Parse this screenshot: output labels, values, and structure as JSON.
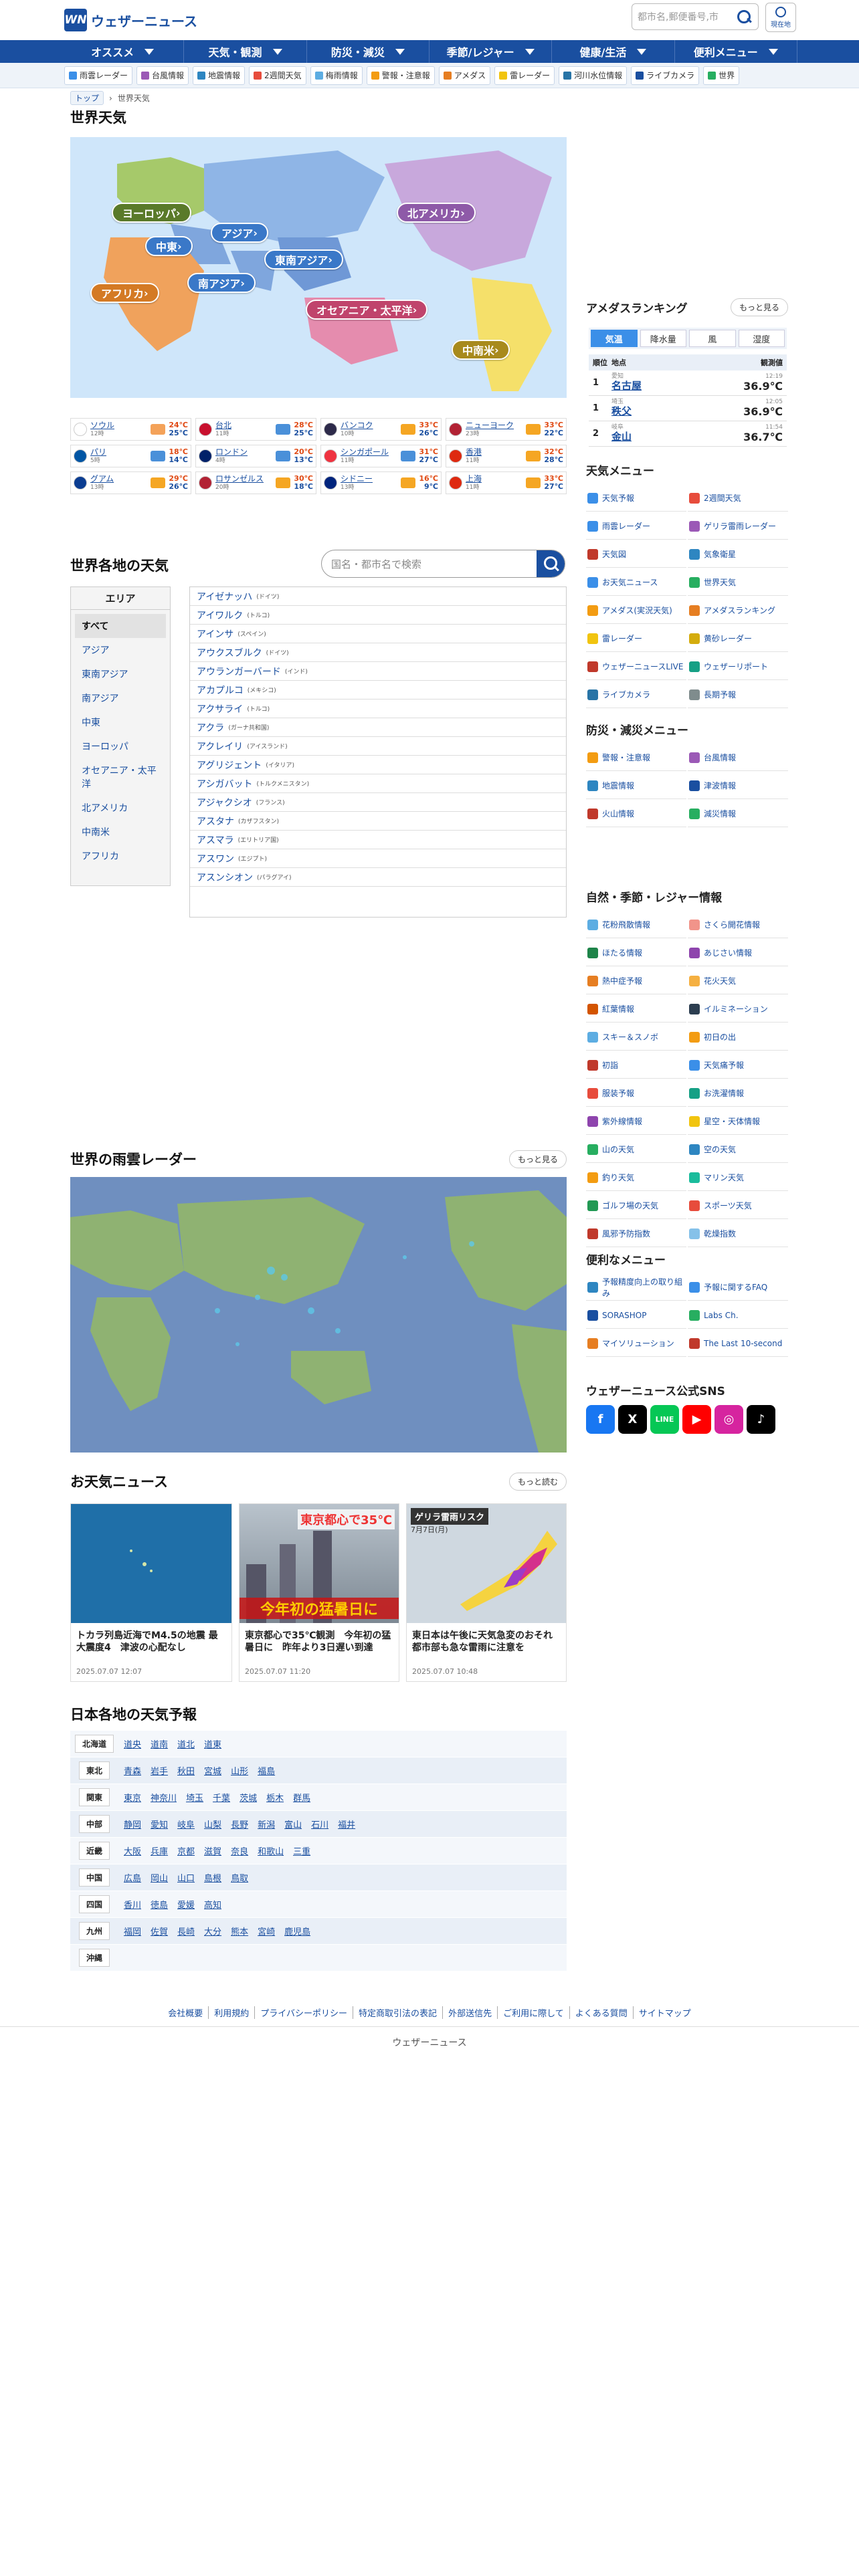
{
  "header": {
    "logo_mark": "WN",
    "logo_text": "ウェザーニュース",
    "search_placeholder": "都市名,郵便番号,市",
    "location_label": "現在地"
  },
  "gnav": [
    "オススメ",
    "天気・観測",
    "防災・減災",
    "季節/レジャー",
    "健康/生活",
    "便利メニュー"
  ],
  "subnav": [
    {
      "label": "雨雲レーダー",
      "color": "#3b8fe8"
    },
    {
      "label": "台風情報",
      "color": "#9b59b6"
    },
    {
      "label": "地震情報",
      "color": "#2e86c1"
    },
    {
      "label": "2週間天気",
      "color": "#e74c3c"
    },
    {
      "label": "梅雨情報",
      "color": "#5dade2"
    },
    {
      "label": "警報・注意報",
      "color": "#f39c12"
    },
    {
      "label": "アメダス",
      "color": "#e67e22"
    },
    {
      "label": "雷レーダー",
      "color": "#f1c40f"
    },
    {
      "label": "河川水位情報",
      "color": "#2874a6"
    },
    {
      "label": "ライブカメラ",
      "color": "#1a4fa0"
    },
    {
      "label": "世界",
      "color": "#27ae60"
    }
  ],
  "breadcrumb": {
    "home": "トップ",
    "current": "世界天気"
  },
  "page_title": "世界天気",
  "regions": [
    {
      "label": "ヨーロッパ",
      "color": "#5a7a2a"
    },
    {
      "label": "アジア",
      "color": "#3a78c8"
    },
    {
      "label": "中東",
      "color": "#3a78c8"
    },
    {
      "label": "北アメリカ",
      "color": "#8e5aa8"
    },
    {
      "label": "東南アジア",
      "color": "#3a78c8"
    },
    {
      "label": "アフリカ",
      "color": "#d47a24"
    },
    {
      "label": "南アジア",
      "color": "#3a78c8"
    },
    {
      "label": "オセアニア・太平洋",
      "color": "#c0446c"
    },
    {
      "label": "中南米",
      "color": "#a88a1c"
    }
  ],
  "cities": [
    {
      "name": "ソウル",
      "time": "12時",
      "hi": "24℃",
      "lo": "25℃",
      "flag": "#ffffff",
      "icon": "#f4a259"
    },
    {
      "name": "台北",
      "time": "11時",
      "hi": "28℃",
      "lo": "25℃",
      "flag": "#c8102e",
      "icon": "#4a90d9"
    },
    {
      "name": "バンコク",
      "time": "10時",
      "hi": "33℃",
      "lo": "26℃",
      "flag": "#2d2a4a",
      "icon": "#f5a623"
    },
    {
      "name": "ニューヨーク",
      "time": "23時",
      "hi": "33℃",
      "lo": "22℃",
      "flag": "#b22234",
      "icon": "#f5a623"
    },
    {
      "name": "パリ",
      "time": "5時",
      "hi": "18℃",
      "lo": "14℃",
      "flag": "#0055a4",
      "icon": "#4a90d9"
    },
    {
      "name": "ロンドン",
      "time": "4時",
      "hi": "20℃",
      "lo": "13℃",
      "flag": "#012169",
      "icon": "#4a90d9"
    },
    {
      "name": "シンガポール",
      "time": "11時",
      "hi": "31℃",
      "lo": "27℃",
      "flag": "#ef3340",
      "icon": "#4a90d9"
    },
    {
      "name": "香港",
      "time": "11時",
      "hi": "32℃",
      "lo": "28℃",
      "flag": "#de2910",
      "icon": "#f5a623"
    },
    {
      "name": "グアム",
      "time": "13時",
      "hi": "29℃",
      "lo": "26℃",
      "flag": "#0b3d91",
      "icon": "#f5a623"
    },
    {
      "name": "ロサンゼルス",
      "time": "20時",
      "hi": "30℃",
      "lo": "18℃",
      "flag": "#b22234",
      "icon": "#f5a623"
    },
    {
      "name": "シドニー",
      "time": "13時",
      "hi": "16℃",
      "lo": "9℃",
      "flag": "#00247d",
      "icon": "#f5a623"
    },
    {
      "name": "上海",
      "time": "11時",
      "hi": "33℃",
      "lo": "27℃",
      "flag": "#de2910",
      "icon": "#f5a623"
    }
  ],
  "area_section": {
    "title": "世界各地の天気",
    "search_placeholder": "国名・都市名で検索",
    "area_header": "エリア",
    "areas": [
      "すべて",
      "アジア",
      "東南アジア",
      "南アジア",
      "中東",
      "ヨーロッパ",
      "オセアニア・太平洋",
      "北アメリカ",
      "中南米",
      "アフリカ"
    ],
    "city_list": [
      {
        "name": "アイゼナッハ",
        "country": "(ドイツ)"
      },
      {
        "name": "アイワルク",
        "country": "(トルコ)"
      },
      {
        "name": "アインサ",
        "country": "(スペイン)"
      },
      {
        "name": "アウクスブルク",
        "country": "(ドイツ)"
      },
      {
        "name": "アウランガーバード",
        "country": "(インド)"
      },
      {
        "name": "アカプルコ",
        "country": "(メキシコ)"
      },
      {
        "name": "アクサライ",
        "country": "(トルコ)"
      },
      {
        "name": "アクラ",
        "country": "(ガーナ共和国)"
      },
      {
        "name": "アクレイリ",
        "country": "(アイスランド)"
      },
      {
        "name": "アグリジェント",
        "country": "(イタリア)"
      },
      {
        "name": "アシガバット",
        "country": "(トルクメニスタン)"
      },
      {
        "name": "アジャクシオ",
        "country": "(フランス)"
      },
      {
        "name": "アスタナ",
        "country": "(カザフスタン)"
      },
      {
        "name": "アスマラ",
        "country": "(エリトリア国)"
      },
      {
        "name": "アスワン",
        "country": "(エジプト)"
      },
      {
        "name": "アスンシオン",
        "country": "(パラグアイ)"
      }
    ]
  },
  "radar_section": {
    "title": "世界の雨雲レーダー",
    "more": "もっと見る"
  },
  "news_section": {
    "title": "お天気ニュース",
    "more": "もっと読む",
    "items": [
      {
        "title": "トカラ列島近海でM4.5の地震 最大震度4　津波の心配なし",
        "date": "2025.07.07 12:07",
        "img_caption": ""
      },
      {
        "title": "東京都心で35℃観測　今年初の猛暑日に　昨年より3日遅い到達",
        "date": "2025.07.07 11:20",
        "img_caption": "東京都心で35℃",
        "img_caption2": "今年初の猛暑日に"
      },
      {
        "title": "東日本は午後に天気急変のおそれ　都市部も急な雷雨に注意を",
        "date": "2025.07.07 10:48",
        "img_caption": "ゲリラ雷雨リスク",
        "img_caption2": "7月7日(月)"
      }
    ]
  },
  "forecast_section": {
    "title": "日本各地の天気予報",
    "rows": [
      {
        "region": "北海道",
        "prefs": [
          "道央",
          "道南",
          "道北",
          "道東"
        ]
      },
      {
        "region": "東北",
        "prefs": [
          "青森",
          "岩手",
          "秋田",
          "宮城",
          "山形",
          "福島"
        ]
      },
      {
        "region": "関東",
        "prefs": [
          "東京",
          "神奈川",
          "埼玉",
          "千葉",
          "茨城",
          "栃木",
          "群馬"
        ]
      },
      {
        "region": "中部",
        "prefs": [
          "静岡",
          "愛知",
          "岐阜",
          "山梨",
          "長野",
          "新潟",
          "富山",
          "石川",
          "福井"
        ]
      },
      {
        "region": "近畿",
        "prefs": [
          "大阪",
          "兵庫",
          "京都",
          "滋賀",
          "奈良",
          "和歌山",
          "三重"
        ]
      },
      {
        "region": "中国",
        "prefs": [
          "広島",
          "岡山",
          "山口",
          "島根",
          "鳥取"
        ]
      },
      {
        "region": "四国",
        "prefs": [
          "香川",
          "徳島",
          "愛媛",
          "高知"
        ]
      },
      {
        "region": "九州",
        "prefs": [
          "福岡",
          "佐賀",
          "長崎",
          "大分",
          "熊本",
          "宮崎",
          "鹿児島"
        ]
      },
      {
        "region": "沖縄",
        "prefs": []
      }
    ]
  },
  "footer": {
    "links": [
      "会社概要",
      "利用規約",
      "プライバシーポリシー",
      "特定商取引法の表記",
      "外部送信先",
      "ご利用に際して",
      "よくある質問",
      "サイトマップ"
    ],
    "copyright": "ウェザーニュース"
  },
  "sidebar": {
    "amedas": {
      "title": "アメダスランキング",
      "more": "もっと見る",
      "tabs": [
        "気温",
        "降水量",
        "風",
        "湿度"
      ],
      "header": {
        "rank": "順位",
        "place": "地点",
        "time": "観測値"
      },
      "rows": [
        {
          "rank": "1",
          "pref": "愛知",
          "place": "名古屋",
          "time": "12:19",
          "value": "36.9℃"
        },
        {
          "rank": "1",
          "pref": "埼玉",
          "place": "秩父",
          "time": "12:05",
          "value": "36.9℃"
        },
        {
          "rank": "2",
          "pref": "岐阜",
          "place": "金山",
          "time": "11:54",
          "value": "36.7℃"
        }
      ]
    },
    "weather_menu": {
      "title": "天気メニュー",
      "items": [
        {
          "label": "天気予報",
          "color": "#3b8fe8"
        },
        {
          "label": "2週間天気",
          "color": "#e74c3c"
        },
        {
          "label": "雨雲レーダー",
          "color": "#3b8fe8"
        },
        {
          "label": "ゲリラ雷雨レーダー",
          "color": "#9b59b6"
        },
        {
          "label": "天気図",
          "color": "#c0392b"
        },
        {
          "label": "気象衛星",
          "color": "#2e86c1"
        },
        {
          "label": "お天気ニュース",
          "color": "#3b8fe8"
        },
        {
          "label": "世界天気",
          "color": "#27ae60"
        },
        {
          "label": "アメダス(実況天気)",
          "color": "#f39c12"
        },
        {
          "label": "アメダスランキング",
          "color": "#e67e22"
        },
        {
          "label": "雷レーダー",
          "color": "#f1c40f"
        },
        {
          "label": "黄砂レーダー",
          "color": "#d4ac0d"
        },
        {
          "label": "ウェザーニュースLIVE",
          "color": "#c0392b"
        },
        {
          "label": "ウェザーリポート",
          "color": "#16a085"
        },
        {
          "label": "ライブカメラ",
          "color": "#2874a6"
        },
        {
          "label": "長期予報",
          "color": "#7f8c8d"
        }
      ]
    },
    "disaster_menu": {
      "title": "防災・減災メニュー",
      "items": [
        {
          "label": "警報・注意報",
          "color": "#f39c12"
        },
        {
          "label": "台風情報",
          "color": "#9b59b6"
        },
        {
          "label": "地震情報",
          "color": "#2e86c1"
        },
        {
          "label": "津波情報",
          "color": "#1a4fa0"
        },
        {
          "label": "火山情報",
          "color": "#c0392b"
        },
        {
          "label": "減災情報",
          "color": "#27ae60"
        }
      ]
    },
    "season_menu": {
      "title": "自然・季節・レジャー情報",
      "items": [
        {
          "label": "花粉飛散情報",
          "color": "#5dade2"
        },
        {
          "label": "さくら開花情報",
          "color": "#f1948a"
        },
        {
          "label": "ほたる情報",
          "color": "#1e8449"
        },
        {
          "label": "あじさい情報",
          "color": "#8e44ad"
        },
        {
          "label": "熱中症予報",
          "color": "#e67e22"
        },
        {
          "label": "花火天気",
          "color": "#f5b041"
        },
        {
          "label": "紅葉情報",
          "color": "#d35400"
        },
        {
          "label": "イルミネーション",
          "color": "#2c3e50"
        },
        {
          "label": "スキー＆スノボ",
          "color": "#5dade2"
        },
        {
          "label": "初日の出",
          "color": "#f39c12"
        },
        {
          "label": "初詣",
          "color": "#c0392b"
        },
        {
          "label": "天気痛予報",
          "color": "#3b8fe8"
        },
        {
          "label": "服装予報",
          "color": "#e74c3c"
        },
        {
          "label": "お洗濯情報",
          "color": "#16a085"
        },
        {
          "label": "紫外線情報",
          "color": "#8e44ad"
        },
        {
          "label": "星空・天体情報",
          "color": "#f1c40f"
        },
        {
          "label": "山の天気",
          "color": "#27ae60"
        },
        {
          "label": "空の天気",
          "color": "#2e86c1"
        },
        {
          "label": "釣り天気",
          "color": "#f39c12"
        },
        {
          "label": "マリン天気",
          "color": "#1abc9c"
        },
        {
          "label": "ゴルフ場の天気",
          "color": "#229954"
        },
        {
          "label": "スポーツ天気",
          "color": "#e74c3c"
        },
        {
          "label": "風邪予防指数",
          "color": "#c0392b"
        },
        {
          "label": "乾燥指数",
          "color": "#85c1e9"
        }
      ]
    },
    "useful_menu": {
      "title": "便利なメニュー",
      "items": [
        {
          "label": "予報精度向上の取り組み",
          "color": "#2e86c1"
        },
        {
          "label": "予報に関するFAQ",
          "color": "#3b8fe8"
        },
        {
          "label": "SORASHOP",
          "color": "#1a4fa0"
        },
        {
          "label": "Labs Ch.",
          "color": "#27ae60"
        },
        {
          "label": "マイソリューション",
          "color": "#e67e22"
        },
        {
          "label": "The Last 10-second",
          "color": "#c0392b"
        }
      ]
    },
    "sns": {
      "title": "ウェザーニュース公式SNS",
      "items": [
        {
          "label": "f",
          "name": "facebook-icon",
          "color": "#1877f2"
        },
        {
          "label": "X",
          "name": "x-icon",
          "color": "#000000"
        },
        {
          "label": "LINE",
          "name": "line-icon",
          "color": "#06c755"
        },
        {
          "label": "▶",
          "name": "youtube-icon",
          "color": "#ff0000"
        },
        {
          "label": "◎",
          "name": "instagram-icon",
          "color": "#d6249f"
        },
        {
          "label": "♪",
          "name": "tiktok-icon",
          "color": "#000000"
        }
      ]
    }
  }
}
